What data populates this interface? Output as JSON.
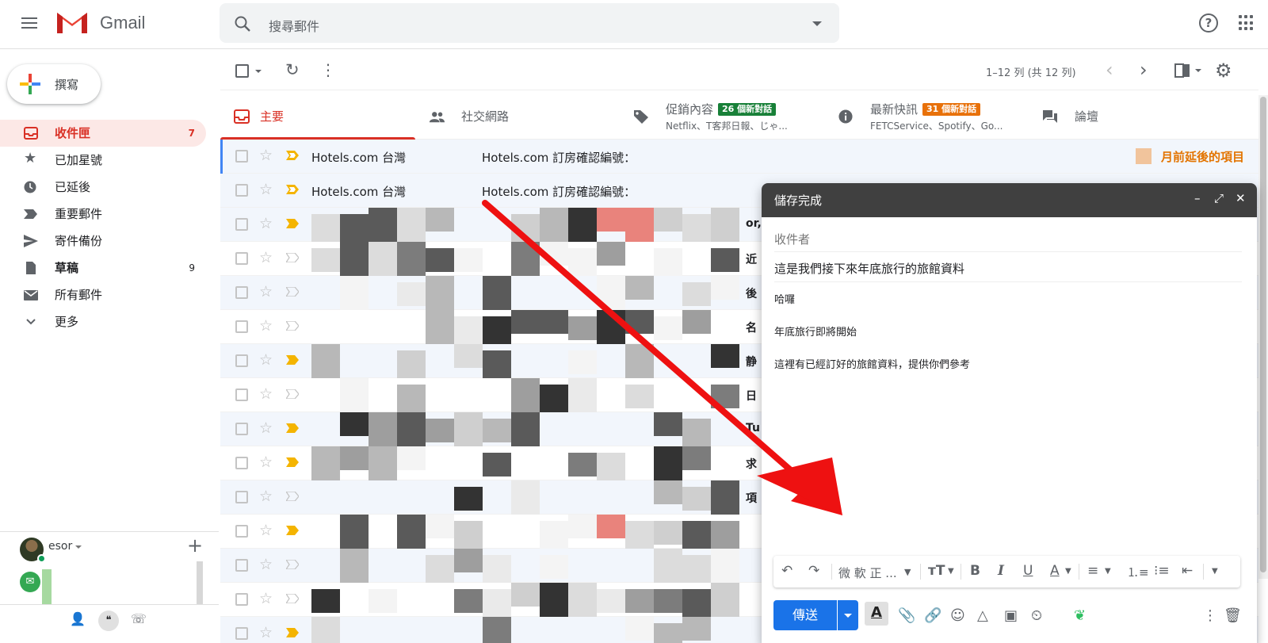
{
  "app": {
    "name": "Gmail"
  },
  "header": {
    "search_placeholder": "搜尋郵件"
  },
  "compose_button": {
    "label": "撰寫"
  },
  "nav": [
    {
      "label": "收件匣",
      "count": "7",
      "icon": "inbox-icon",
      "active": true
    },
    {
      "label": "已加星號",
      "count": "",
      "icon": "star-icon"
    },
    {
      "label": "已延後",
      "count": "",
      "icon": "clock-icon"
    },
    {
      "label": "重要郵件",
      "count": "",
      "icon": "important-icon"
    },
    {
      "label": "寄件備份",
      "count": "",
      "icon": "send-icon"
    },
    {
      "label": "草稿",
      "count": "9",
      "icon": "draft-icon",
      "bold": true
    },
    {
      "label": "所有郵件",
      "count": "",
      "icon": "mail-icon"
    },
    {
      "label": "更多",
      "count": "",
      "icon": "chevron-down-icon"
    }
  ],
  "hangouts": {
    "user_name": "esor"
  },
  "toolbar": {
    "pagination": "1–12 列 (共 12 列)"
  },
  "tabs": [
    {
      "label": "主要",
      "badge": "",
      "sub": "",
      "active": true
    },
    {
      "label": "社交網路",
      "badge": "",
      "sub": ""
    },
    {
      "label": "促銷內容",
      "badge": "26 個新對話",
      "badge_color": "#188038",
      "sub": "Netflix、T客邦日報、じゃ..."
    },
    {
      "label": "最新快訊",
      "badge": "31 個新對話",
      "badge_color": "#e8710a",
      "sub": "FETCService、Spotify、Go..."
    },
    {
      "label": "論壇",
      "badge": "",
      "sub": ""
    }
  ],
  "emails": [
    {
      "sender": "Hotels.com 台灣",
      "subject": "Hotels.com 訂房確認編號：",
      "tag": "月前延後的項目"
    },
    {
      "sender": "Hotels.com 台灣",
      "subject": "Hotels.com 訂房確認編號：",
      "tag": ""
    }
  ],
  "email_snippets": [
    "or,",
    "近",
    "後",
    "名",
    "静",
    "日",
    "Tu",
    "求",
    "項"
  ],
  "composer": {
    "title": "儲存完成",
    "to_placeholder": "收件者",
    "subject": "這是我們接下來年底旅行的旅館資料",
    "body": [
      "哈囉",
      "年底旅行即將開始",
      "這裡有已經訂好的旅館資料，提供你們參考"
    ],
    "font": "微 軟 正 ...",
    "send_label": "傳送"
  },
  "colors": {
    "accent_red": "#d93025",
    "send_blue": "#1a73e8",
    "annotation_arrow": "#ee1111"
  }
}
